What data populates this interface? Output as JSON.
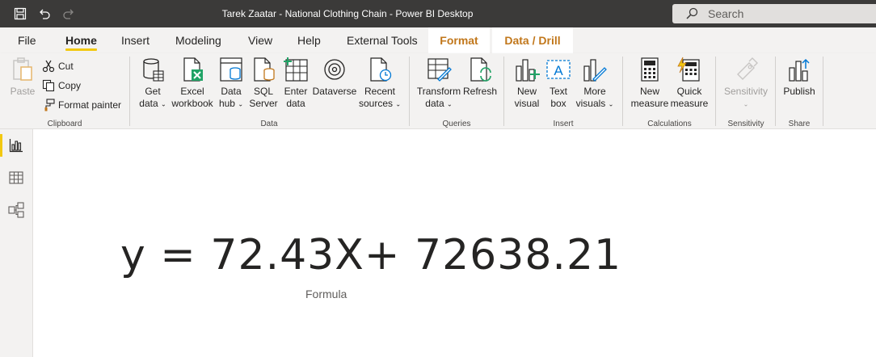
{
  "window": {
    "title": "Tarek Zaatar - National Clothing Chain - Power BI Desktop",
    "search_placeholder": "Search"
  },
  "quick_access": [
    {
      "name": "save-icon"
    },
    {
      "name": "undo-icon"
    },
    {
      "name": "redo-icon"
    }
  ],
  "tabs": {
    "file": "File",
    "home": "Home",
    "insert": "Insert",
    "modeling": "Modeling",
    "view": "View",
    "help": "Help",
    "external_tools": "External Tools",
    "format": "Format",
    "data_drill": "Data / Drill"
  },
  "ribbon": {
    "clipboard": {
      "label": "Clipboard",
      "paste": "Paste",
      "cut": "Cut",
      "copy": "Copy",
      "format_painter": "Format painter"
    },
    "data": {
      "label": "Data",
      "get_data_1": "Get",
      "get_data_2": "data",
      "excel_1": "Excel",
      "excel_2": "workbook",
      "datahub_1": "Data",
      "datahub_2": "hub",
      "sql_1": "SQL",
      "sql_2": "Server",
      "enter_1": "Enter",
      "enter_2": "data",
      "dataverse": "Dataverse",
      "recent_1": "Recent",
      "recent_2": "sources"
    },
    "queries": {
      "label": "Queries",
      "transform_1": "Transform",
      "transform_2": "data",
      "refresh": "Refresh"
    },
    "insert": {
      "label": "Insert",
      "new_visual_1": "New",
      "new_visual_2": "visual",
      "text_box_1": "Text",
      "text_box_2": "box",
      "more_visuals_1": "More",
      "more_visuals_2": "visuals"
    },
    "calculations": {
      "label": "Calculations",
      "new_measure_1": "New",
      "new_measure_2": "measure",
      "quick_measure_1": "Quick",
      "quick_measure_2": "measure"
    },
    "sensitivity": {
      "label": "Sensitivity",
      "button": "Sensitivity"
    },
    "share": {
      "label": "Share",
      "publish": "Publish"
    }
  },
  "canvas": {
    "formula": "y = 72.43X+ 72638.21",
    "caption": "Formula"
  },
  "colors": {
    "accent": "#f2c811",
    "titlebar": "#3b3a39",
    "contextual_tab": "#c1771b"
  }
}
